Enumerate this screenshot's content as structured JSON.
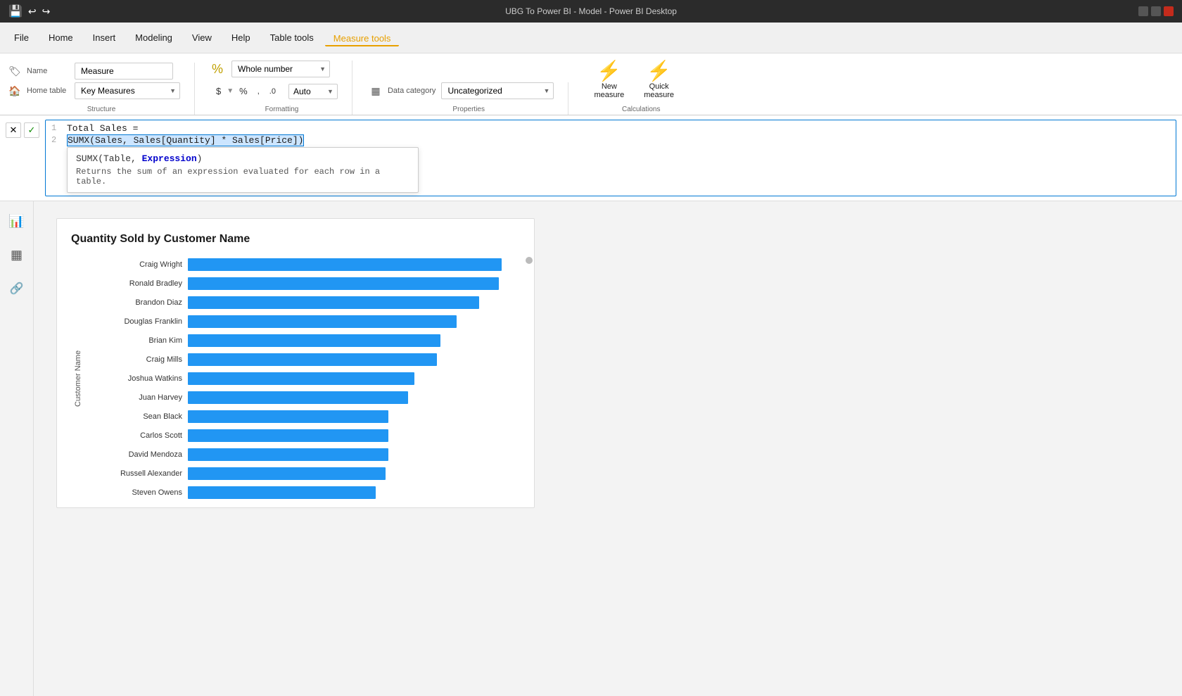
{
  "titlebar": {
    "title": "UBG To Power BI - Model - Power BI Desktop",
    "save_icon": "💾",
    "undo_icon": "↩",
    "redo_icon": "↪"
  },
  "menu": {
    "items": [
      "File",
      "Home",
      "Insert",
      "Modeling",
      "View",
      "Help",
      "Table tools",
      "Measure tools"
    ]
  },
  "ribbon": {
    "name_label": "Name",
    "name_value": "Measure",
    "home_table_label": "Home table",
    "home_table_value": "Key Measures",
    "format_label": "Whole number",
    "data_category_label": "Data category",
    "data_category_value": "Uncategorized",
    "dollar_btn": "$",
    "percent_btn": "%",
    "comma_btn": ",",
    "decimal_btn": ".0",
    "auto_value": "Auto",
    "new_measure_label": "New\nmeasure",
    "quick_measure_label": "Quick\nmeasure",
    "structure_label": "Structure",
    "formatting_label": "Formatting",
    "properties_label": "Properties",
    "calculations_label": "Calculations"
  },
  "formula": {
    "cancel_btn": "✕",
    "confirm_btn": "✓",
    "line1": "Total Sales =",
    "line2_prefix": "SUMX(",
    "line2_highlighted": "Sales, Sales[Quantity] * Sales[Price]",
    "line2_suffix": ")",
    "autocomplete_sig": "SUMX(Table, Expression)",
    "autocomplete_sig_bold": "Expression",
    "autocomplete_desc": "Returns the sum of an expression evaluated for each row in a table."
  },
  "chart": {
    "title": "Quantity Sold by Customer Name",
    "y_axis_label": "Customer Name",
    "bars": [
      {
        "label": "Craig Wright",
        "pct": 97
      },
      {
        "label": "Ronald Bradley",
        "pct": 96
      },
      {
        "label": "Brandon Diaz",
        "pct": 90
      },
      {
        "label": "Douglas Franklin",
        "pct": 83
      },
      {
        "label": "Brian Kim",
        "pct": 78
      },
      {
        "label": "Craig Mills",
        "pct": 77
      },
      {
        "label": "Joshua Watkins",
        "pct": 70
      },
      {
        "label": "Juan Harvey",
        "pct": 68
      },
      {
        "label": "Sean Black",
        "pct": 62
      },
      {
        "label": "Carlos Scott",
        "pct": 62
      },
      {
        "label": "David Mendoza",
        "pct": 62
      },
      {
        "label": "Russell Alexander",
        "pct": 61
      },
      {
        "label": "Steven Owens",
        "pct": 58
      }
    ]
  },
  "left_panel_icons": [
    "📊",
    "▦",
    "🔗"
  ]
}
